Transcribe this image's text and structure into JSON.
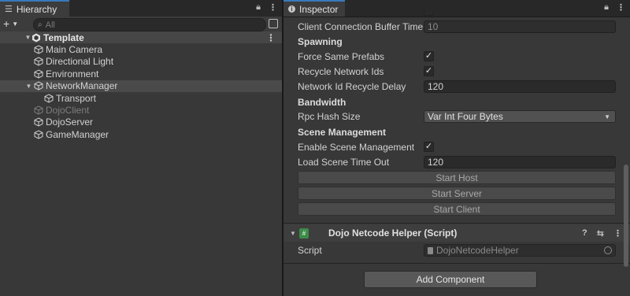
{
  "hierarchy": {
    "tab_label": "Hierarchy",
    "add_label": "+",
    "search_placeholder": "All",
    "items": [
      {
        "label": "Template",
        "depth": 0,
        "icon": "unity-scene-icon",
        "expanded": true,
        "scene": true
      },
      {
        "label": "Main Camera",
        "depth": 1,
        "icon": "gameobject-cube-icon"
      },
      {
        "label": "Directional Light",
        "depth": 1,
        "icon": "gameobject-cube-icon"
      },
      {
        "label": "Environment",
        "depth": 1,
        "icon": "gameobject-cube-icon"
      },
      {
        "label": "NetworkManager",
        "depth": 1,
        "icon": "gameobject-cube-icon",
        "expanded": true,
        "selected": true
      },
      {
        "label": "Transport",
        "depth": 2,
        "icon": "gameobject-cube-icon"
      },
      {
        "label": "DojoClient",
        "depth": 1,
        "icon": "gameobject-cube-icon",
        "inactive": true
      },
      {
        "label": "DojoServer",
        "depth": 1,
        "icon": "gameobject-cube-icon"
      },
      {
        "label": "GameManager",
        "depth": 1,
        "icon": "gameobject-cube-icon"
      }
    ]
  },
  "inspector": {
    "tab_label": "Inspector",
    "client_buffer": {
      "label": "Client Connection Buffer Time",
      "value": "10"
    },
    "spawning_header": "Spawning",
    "force_same_prefabs": {
      "label": "Force Same Prefabs",
      "checked": true
    },
    "recycle_ids": {
      "label": "Recycle Network Ids",
      "checked": true
    },
    "recycle_delay": {
      "label": "Network Id Recycle Delay",
      "value": "120"
    },
    "bandwidth_header": "Bandwidth",
    "rpc_hash": {
      "label": "Rpc Hash Size",
      "value": "Var Int Four Bytes"
    },
    "scene_header": "Scene Management",
    "enable_scene": {
      "label": "Enable Scene Management",
      "checked": true
    },
    "load_timeout": {
      "label": "Load Scene Time Out",
      "value": "120"
    },
    "buttons": {
      "start_host": "Start Host",
      "start_server": "Start Server",
      "start_client": "Start Client"
    },
    "component": {
      "title": "Dojo Netcode Helper (Script)",
      "script_label": "Script",
      "script_value": "DojoNetcodeHelper"
    },
    "add_component": "Add Component"
  },
  "colors": {
    "accent": "#3a79bb",
    "panel": "#383838",
    "field": "#2a2a2a",
    "script_icon": "#3d8b48"
  }
}
